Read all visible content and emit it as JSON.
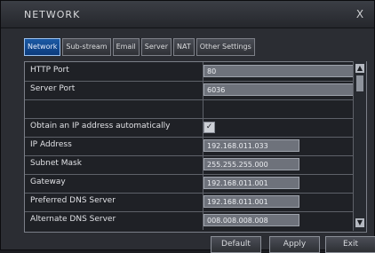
{
  "window": {
    "title": "NETWORK",
    "close_label": "X"
  },
  "tabs": [
    {
      "label": "Network",
      "active": true
    },
    {
      "label": "Sub-stream"
    },
    {
      "label": "Email"
    },
    {
      "label": "Server"
    },
    {
      "label": "NAT"
    },
    {
      "label": "Other Settings"
    }
  ],
  "settings": {
    "http_port": {
      "label": "HTTP Port",
      "value": "80"
    },
    "server_port": {
      "label": "Server Port",
      "value": "6036"
    },
    "dhcp": {
      "label": "Obtain an IP address automatically",
      "checked": true,
      "check_glyph": "✓"
    },
    "ip_address": {
      "label": "IP Address",
      "value": "192.168.011.033"
    },
    "subnet_mask": {
      "label": "Subnet Mask",
      "value": "255.255.255.000"
    },
    "gateway": {
      "label": "Gateway",
      "value": "192.168.011.001"
    },
    "preferred_dns": {
      "label": "Preferred DNS Server",
      "value": "192.168.011.001"
    },
    "alternate_dns": {
      "label": "Alternate DNS Server",
      "value": "008.008.008.008"
    }
  },
  "scroll": {
    "up_label": "▲",
    "down_label": "▼"
  },
  "buttons": {
    "default": "Default",
    "apply": "Apply",
    "exit": "Exit"
  },
  "colors": {
    "accent": "#1b5aa5",
    "panel": "#2b2d33",
    "field": "#6e727b"
  }
}
